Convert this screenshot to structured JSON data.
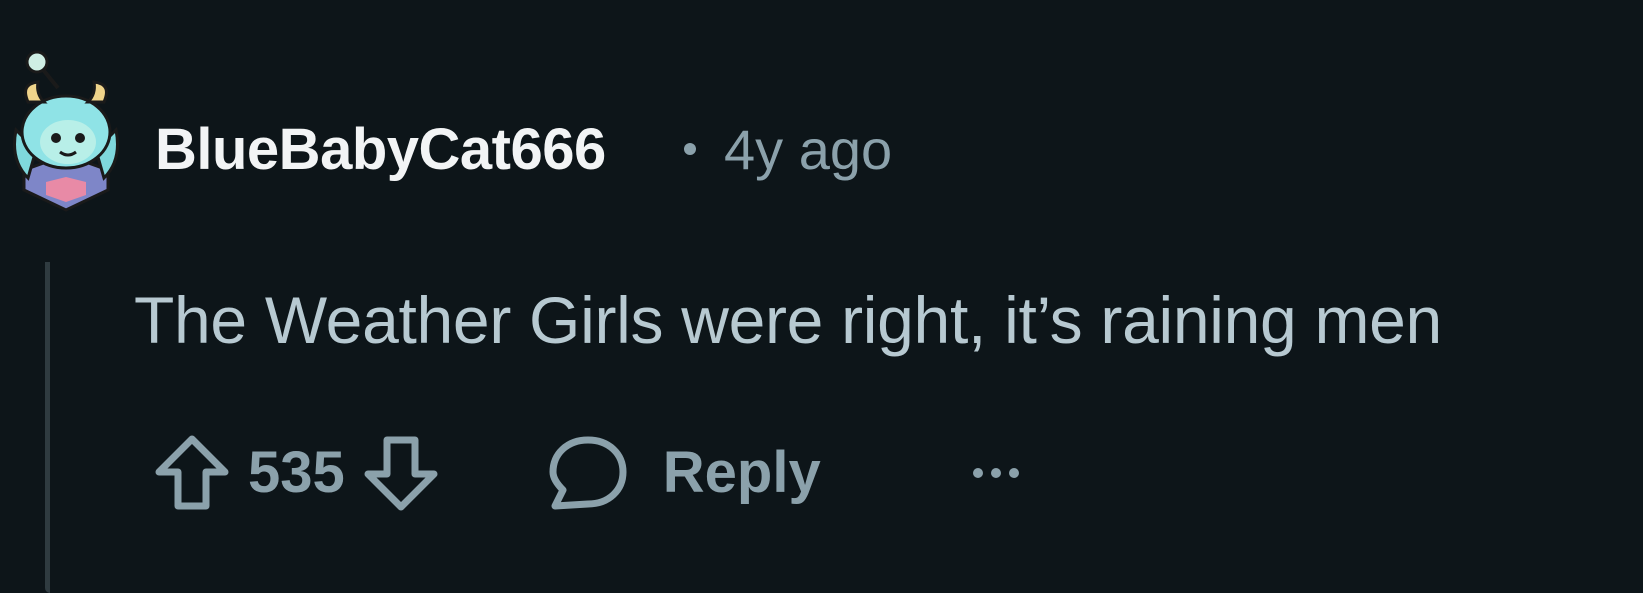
{
  "comment": {
    "author": "BlueBabyCat666",
    "timestamp": "4y ago",
    "body": "The Weather Girls were right, it’s raining men",
    "score": "535",
    "reply_label": "Reply",
    "more_label": "..."
  },
  "icons": {
    "avatar": "snoo-avatar",
    "upvote": "upvote-arrow-icon",
    "downvote": "downvote-arrow-icon",
    "reply": "speech-bubble-icon",
    "more": "ellipsis-icon"
  },
  "colors": {
    "background": "#0d1519",
    "author": "#f2f4f5",
    "body_text": "#b7c9d1",
    "secondary": "#8ba1ab",
    "thread_line": "#2f3b40"
  }
}
